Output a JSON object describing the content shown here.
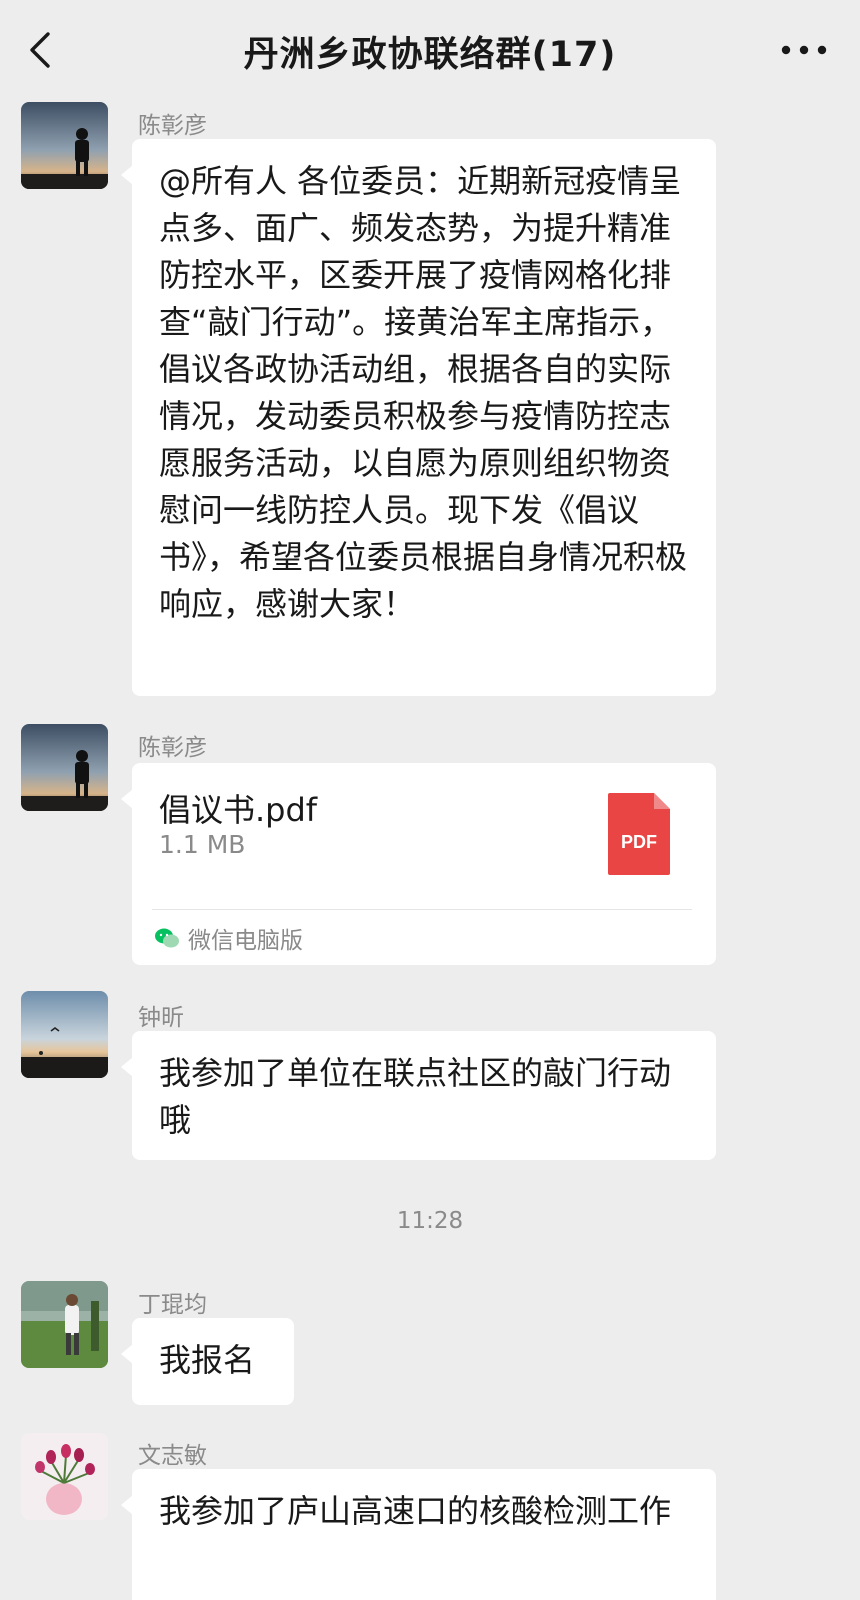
{
  "header": {
    "title": "丹洲乡政协联络群(17)",
    "back_icon": "chevron-left-icon",
    "more_icon": "more-dots-icon"
  },
  "messages": [
    {
      "sender": "陈彰彦",
      "avatar": "avatar-silhouette-sunset",
      "type": "text",
      "text": "@所有人  各位委员：近期新冠疫情呈点多、面广、频发态势，为提升精准防控水平，区委开展了疫情网格化排查“敲门行动”。接黄治军主席指示，倡议各政协活动组，根据各自的实际情况，发动委员积极参与疫情防控志愿服务活动，以自愿为原则组织物资慰问一线防控人员。现下发《倡议书》，希望各位委员根据自身情况积极响应，感谢大家！"
    },
    {
      "sender": "陈彰彦",
      "avatar": "avatar-silhouette-sunset",
      "type": "file",
      "file": {
        "name": "倡议书.pdf",
        "size": "1.1 MB",
        "icon_label": "PDF",
        "icon_color": "#e94545",
        "source": "微信电脑版"
      }
    },
    {
      "sender": "钟昕",
      "avatar": "avatar-beach-dusk",
      "type": "text",
      "text": "我参加了单位在联点社区的敲门行动哦"
    },
    {
      "timestamp": "11:28"
    },
    {
      "sender": "丁琨均",
      "avatar": "avatar-golf-course",
      "type": "text",
      "text": "我报名"
    },
    {
      "sender": "文志敏",
      "avatar": "avatar-flowers-vase",
      "type": "text",
      "text": "我参加了庐山高速口的核酸检测工作"
    }
  ],
  "colors": {
    "background": "#ededed",
    "bubble": "#ffffff",
    "meta_text": "#8a8a8a",
    "pdf_red": "#e94545",
    "wechat_green": "#07c160"
  }
}
